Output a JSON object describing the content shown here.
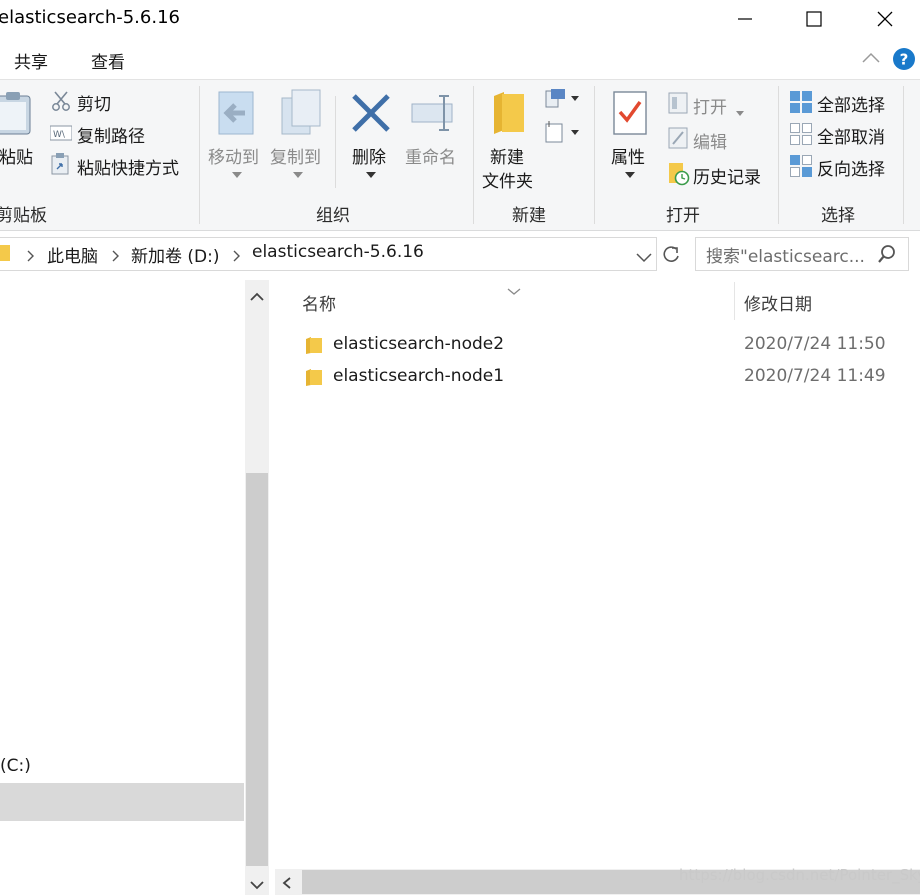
{
  "window": {
    "title": "elasticsearch-5.6.16"
  },
  "menu_tabs": [
    "共享",
    "查看"
  ],
  "ribbon": {
    "clipboard": {
      "paste": "粘贴",
      "cut": "剪切",
      "copy_path": "复制路径",
      "paste_shortcut": "粘贴快捷方式",
      "group": "剪贴板"
    },
    "organize": {
      "move_to": "移动到",
      "copy_to": "复制到",
      "delete": "删除",
      "rename": "重命名",
      "group": "组织"
    },
    "new": {
      "new_folder_line1": "新建",
      "new_folder_line2": "文件夹",
      "group": "新建"
    },
    "open": {
      "properties": "属性",
      "open": "打开",
      "edit": "编辑",
      "history": "历史记录",
      "group": "打开"
    },
    "select": {
      "select_all": "全部选择",
      "select_none": "全部取消",
      "invert": "反向选择",
      "group": "选择"
    }
  },
  "address": {
    "crumbs": [
      "此电脑",
      "新加卷 (D:)",
      "elasticsearch-5.6.16"
    ],
    "search_placeholder": "搜索\"elasticsearc..."
  },
  "nav": {
    "drive_c": "(C:)"
  },
  "columns": {
    "name": "名称",
    "modified": "修改日期"
  },
  "files": [
    {
      "name": "elasticsearch-node2",
      "modified": "2020/7/24 11:50"
    },
    {
      "name": "elasticsearch-node1",
      "modified": "2020/7/24 11:49"
    }
  ],
  "watermark": "https://blog.csdn.net/Pointer_Sky",
  "colors": {
    "accent_blue": "#1979ca",
    "folder_yellow": "#f4c94a",
    "delete_blue": "#3f6fa8",
    "check_red": "#e2492f"
  }
}
